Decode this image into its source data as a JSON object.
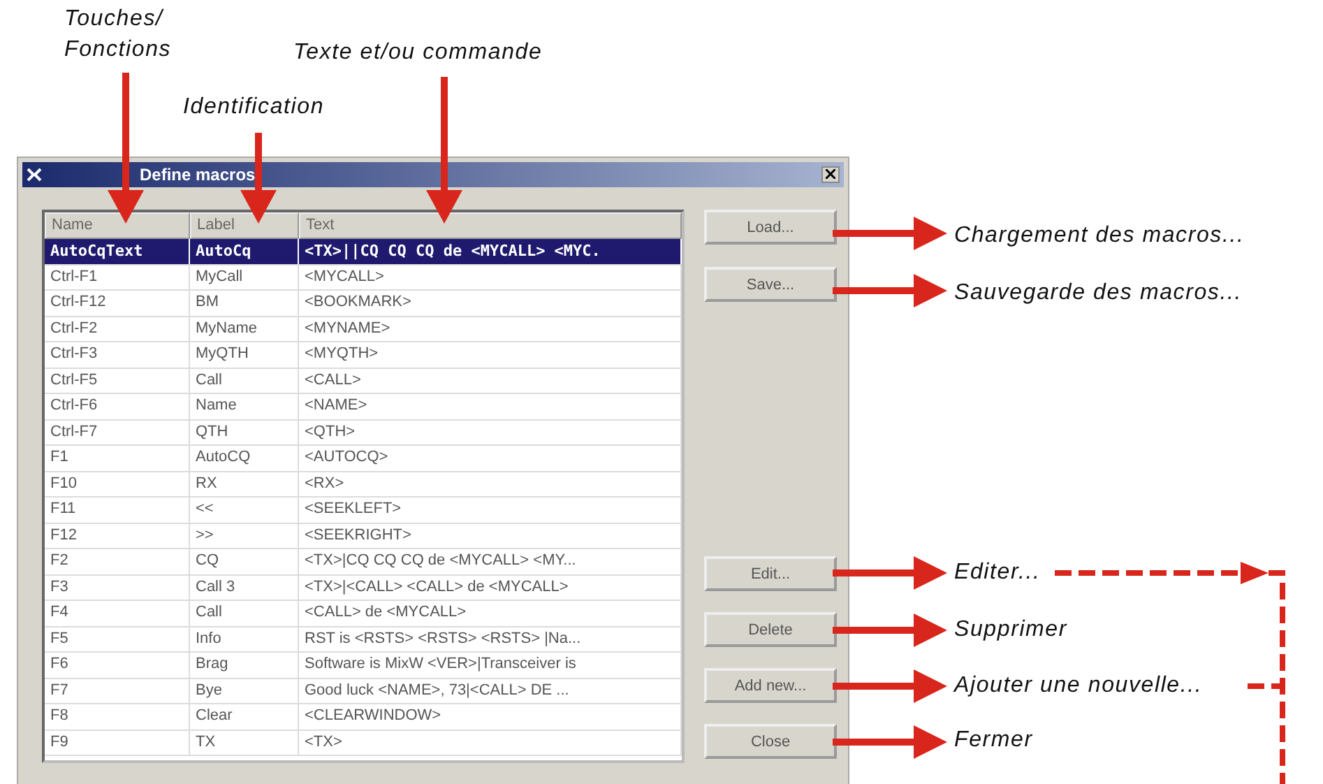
{
  "window": {
    "title": "Define macros"
  },
  "table": {
    "columns": [
      "Name",
      "Label",
      "Text"
    ],
    "rows": [
      {
        "name": "AutoCqText",
        "label": "AutoCq",
        "text": "<TX>||CQ CQ CQ de <MYCALL> <MYC.",
        "selected": true
      },
      {
        "name": "Ctrl-F1",
        "label": "MyCall",
        "text": "<MYCALL>",
        "selected": false
      },
      {
        "name": "Ctrl-F12",
        "label": "BM",
        "text": "<BOOKMARK>",
        "selected": false
      },
      {
        "name": "Ctrl-F2",
        "label": "MyName",
        "text": "<MYNAME>",
        "selected": false
      },
      {
        "name": "Ctrl-F3",
        "label": "MyQTH",
        "text": "<MYQTH>",
        "selected": false
      },
      {
        "name": "Ctrl-F5",
        "label": "Call",
        "text": "<CALL>",
        "selected": false
      },
      {
        "name": "Ctrl-F6",
        "label": "Name",
        "text": "<NAME>",
        "selected": false
      },
      {
        "name": "Ctrl-F7",
        "label": "QTH",
        "text": "<QTH>",
        "selected": false
      },
      {
        "name": "F1",
        "label": "AutoCQ",
        "text": "<AUTOCQ>",
        "selected": false
      },
      {
        "name": "F10",
        "label": "RX",
        "text": "<RX>",
        "selected": false
      },
      {
        "name": "F11",
        "label": "<<",
        "text": "<SEEKLEFT>",
        "selected": false
      },
      {
        "name": "F12",
        "label": ">>",
        "text": "<SEEKRIGHT>",
        "selected": false
      },
      {
        "name": "F2",
        "label": "CQ",
        "text": "<TX>|CQ CQ CQ de <MYCALL> <MY...",
        "selected": false
      },
      {
        "name": "F3",
        "label": "Call 3",
        "text": "<TX>|<CALL> <CALL> de <MYCALL>",
        "selected": false
      },
      {
        "name": "F4",
        "label": "Call",
        "text": "<CALL> de <MYCALL>",
        "selected": false
      },
      {
        "name": "F5",
        "label": "Info",
        "text": "RST is <RSTS> <RSTS> <RSTS> |Na...",
        "selected": false
      },
      {
        "name": "F6",
        "label": "Brag",
        "text": "Software is MixW <VER>|Transceiver is",
        "selected": false
      },
      {
        "name": "F7",
        "label": "Bye",
        "text": "Good luck <NAME>, 73|<CALL> DE ...",
        "selected": false
      },
      {
        "name": "F8",
        "label": "Clear",
        "text": "<CLEARWINDOW>",
        "selected": false
      },
      {
        "name": "F9",
        "label": "TX",
        "text": "<TX>",
        "selected": false
      }
    ]
  },
  "buttons": [
    {
      "label": "Load..."
    },
    {
      "label": "Save..."
    },
    {
      "label": "Edit..."
    },
    {
      "label": "Delete"
    },
    {
      "label": "Add new..."
    },
    {
      "label": "Close"
    }
  ],
  "annotations": [
    {
      "text": "Touches/\nFonctions"
    },
    {
      "text": "Identification"
    },
    {
      "text": "Texte et/ou commande"
    },
    {
      "text": "Chargement des macros..."
    },
    {
      "text": "Sauvegarde des macros..."
    },
    {
      "text": "Editer..."
    },
    {
      "text": "Supprimer"
    },
    {
      "text": "Ajouter une nouvelle..."
    },
    {
      "text": "Fermer"
    }
  ]
}
